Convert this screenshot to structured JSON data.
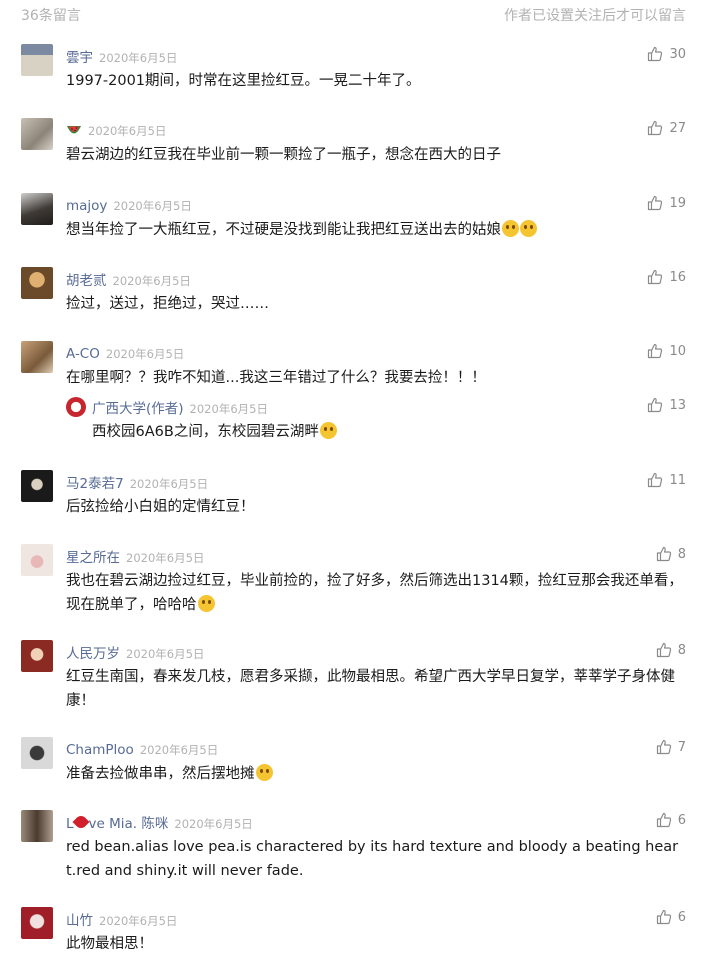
{
  "header": {
    "count_label": "36条留言",
    "note": "作者已设置关注后才可以留言"
  },
  "comments": [
    {
      "name": "雲宇",
      "date": "2020年6月5日",
      "likes": "30",
      "text": "1997-2001期间，时常在这里捡红豆。一晃二十年了。",
      "avatar_color": "#6b6e70"
    },
    {
      "name": "",
      "name_emoji": "watermelon-icon",
      "date": "2020年6月5日",
      "likes": "27",
      "text": "碧云湖边的红豆我在毕业前一颗一颗捡了一瓶子，想念在西大的日子",
      "avatar_color": "#a9a39a"
    },
    {
      "name": "majoy",
      "date": "2020年6月5日",
      "likes": "19",
      "text": "想当年捡了一大瓶红豆，不过硬是没找到能让我把红豆送出去的姑娘",
      "avatar_color": "#3f3a35"
    },
    {
      "name": "胡老贰",
      "date": "2020年6月5日",
      "likes": "16",
      "text": "捡过，送过，拒绝过，哭过……",
      "avatar_color": "#8c6a3d"
    },
    {
      "name": "A-CO",
      "date": "2020年6月5日",
      "likes": "10",
      "text": "在哪里啊？？我咋不知道...我这三年错过了什么？我要去捡！！！",
      "avatar_color": "#9a7a55",
      "reply": {
        "name": "广西大学(作者)",
        "date": "2020年6月5日",
        "likes": "13",
        "text": "西校园6A6B之间，东校园碧云湖畔"
      }
    },
    {
      "name": "马2泰若7",
      "date": "2020年6月5日",
      "likes": "11",
      "text": "后弦捡给小白姐的定情红豆！",
      "avatar_color": "#222222"
    },
    {
      "name": "星之所在",
      "date": "2020年6月5日",
      "likes": "8",
      "text": "我也在碧云湖边捡过红豆，毕业前捡的，捡了好多，然后筛选出1314颗，捡红豆那会我还单看，现在脱单了，哈哈哈",
      "avatar_color": "#d9c9c0"
    },
    {
      "name": "人民万岁",
      "date": "2020年6月5日",
      "likes": "8",
      "text": "红豆生南国，春来发几枝，愿君多采撷，此物最相思。希望广西大学早日复学，莘莘学子身体健康！",
      "avatar_color": "#8a2a22"
    },
    {
      "name": "ChamPloo",
      "date": "2020年6月5日",
      "likes": "7",
      "text": "准备去捡做串串，然后摆地摊",
      "avatar_color": "#6e6e6e"
    },
    {
      "name_before": "L",
      "name_after": "ve Mia. 陈咪",
      "date": "2020年6月5日",
      "likes": "6",
      "text": "red bean.alias love pea.is charactered by its hard texture and bloody a beating heart.red and shiny.it will never fade.",
      "avatar_color": "#7a6a5a"
    },
    {
      "name": "山竹",
      "date": "2020年6月5日",
      "likes": "6",
      "text": "此物最相思！",
      "avatar_color": "#a01e28"
    }
  ],
  "colors": {
    "name": "#576b95",
    "meta": "#b2b2b2",
    "text": "#1a1a1a",
    "like": "#8a8a8a"
  }
}
